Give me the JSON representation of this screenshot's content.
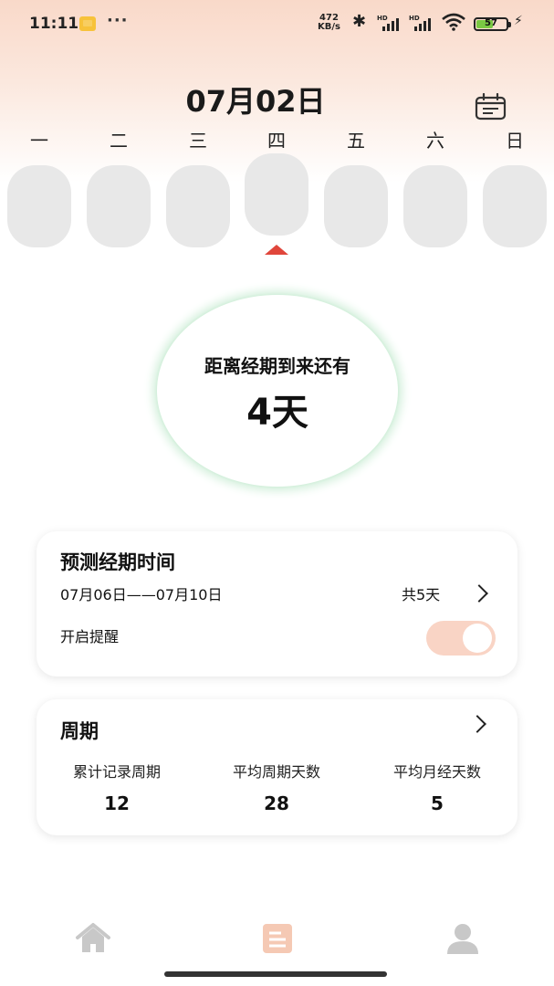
{
  "status_bar": {
    "time": "11:11",
    "more": "···",
    "net_speed_value": "472",
    "net_speed_unit": "KB/s",
    "signal_label_1": "HD",
    "signal_label_2": "HD",
    "battery_level": "57",
    "battery_fraction": 0.57
  },
  "header": {
    "date": "07月02日",
    "calendar_icon": "calendar-icon"
  },
  "week": {
    "days": [
      "一",
      "二",
      "三",
      "四",
      "五",
      "六",
      "日"
    ],
    "selected_index": 3
  },
  "countdown": {
    "label": "距离经期到来还有",
    "value": "4天"
  },
  "prediction": {
    "title": "预测经期时间",
    "range": "07月06日——07月10日",
    "total": "共5天",
    "reminder_label": "开启提醒",
    "reminder_on": true
  },
  "cycle": {
    "title": "周期",
    "stats": [
      {
        "label": "累计记录周期",
        "value": "12"
      },
      {
        "label": "平均周期天数",
        "value": "28"
      },
      {
        "label": "平均月经天数",
        "value": "5"
      }
    ]
  },
  "nav": {
    "items": [
      "home-icon",
      "record-icon",
      "profile-icon"
    ],
    "active_index": 1
  },
  "colors": {
    "accent": "#e0463b",
    "toggle_track": "#f9d4c5",
    "nav_active": "#f5c9b4",
    "nav_inactive": "#c8c8c8",
    "ring_glow": "#d5f0dd"
  }
}
